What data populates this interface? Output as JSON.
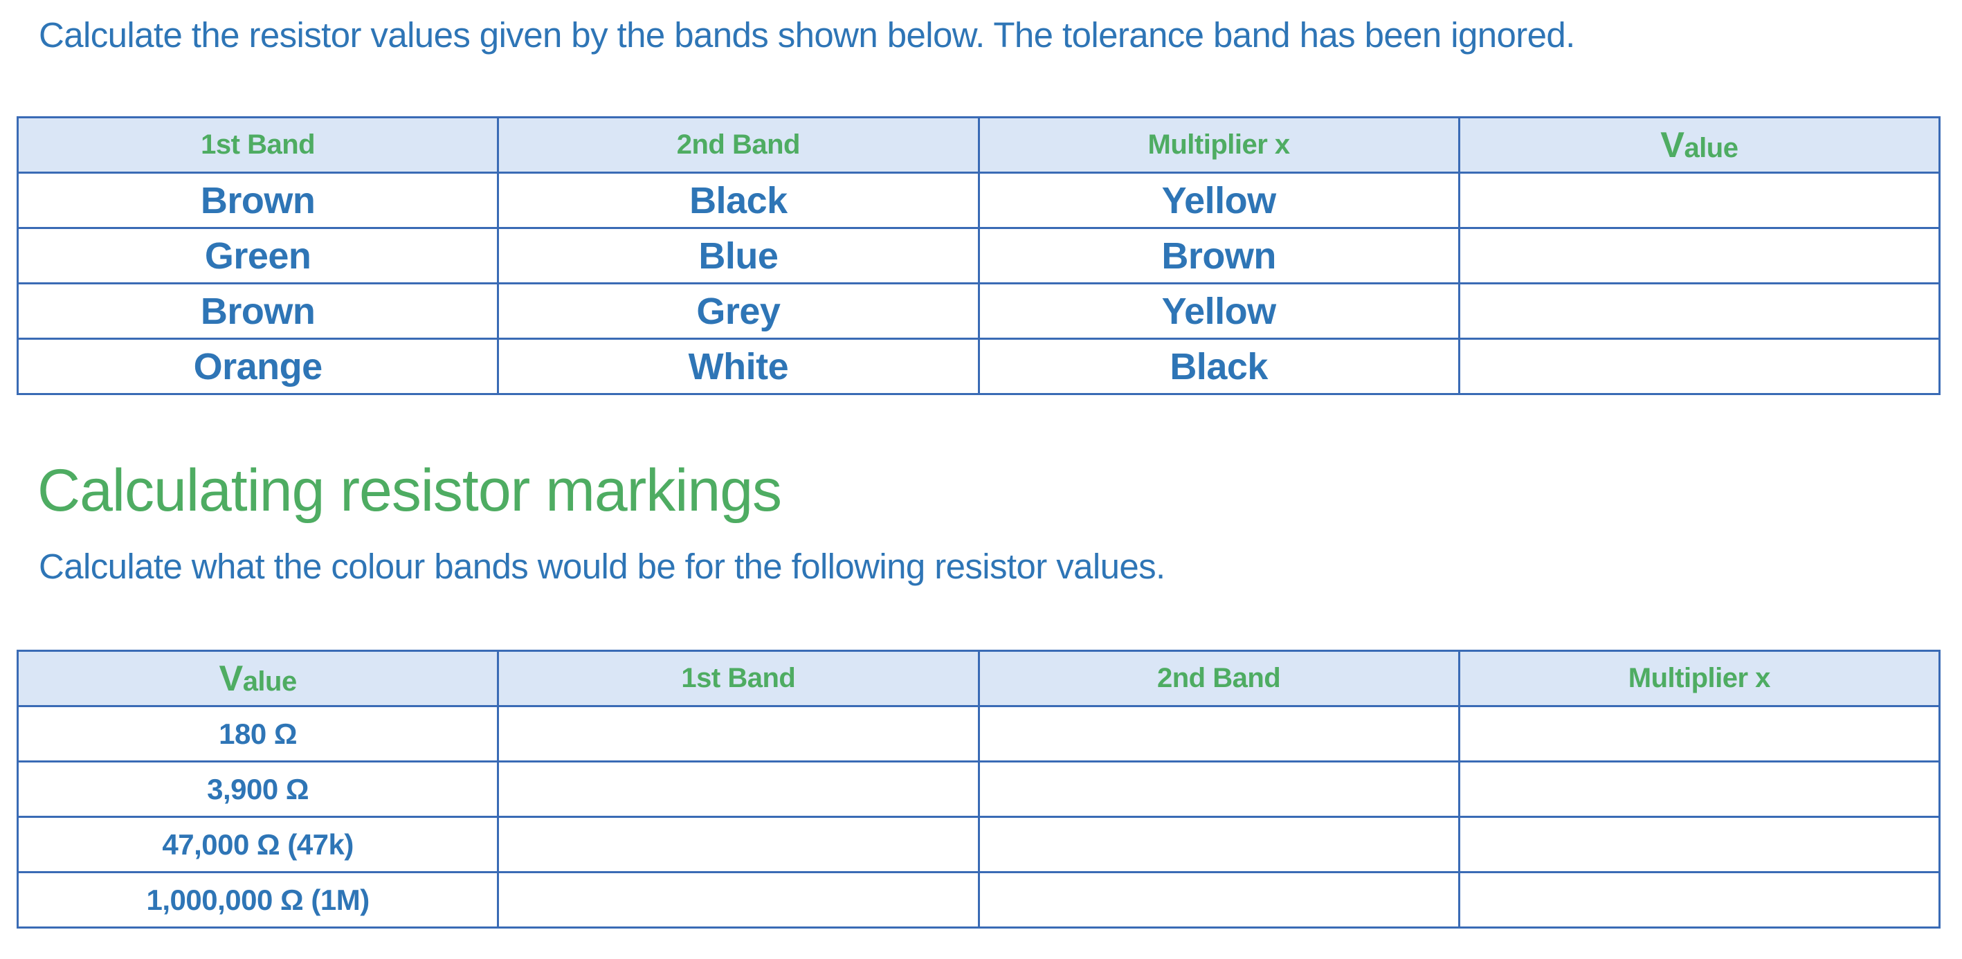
{
  "document": {
    "intro_text": "Calculate the resistor values given by the bands shown below. The tolerance band has been ignored.",
    "section_heading": "Calculating resistor markings",
    "section_instruction": "Calculate what the colour bands would be for the following resistor values.",
    "colors": {
      "body_text": "#2E75B6",
      "heading_text": "#4EAC62",
      "header_bg": "#DAE6F6",
      "border": "#3A6BB5"
    }
  },
  "bands_to_value_table": {
    "headers": [
      "1st Band",
      "2nd Band",
      "Multiplier x",
      "Value"
    ],
    "value_header_initial": "V",
    "value_header_rest": "alue",
    "rows": [
      {
        "first_band": "Brown",
        "second_band": "Black",
        "multiplier": "Yellow",
        "value": ""
      },
      {
        "first_band": "Green",
        "second_band": "Blue",
        "multiplier": "Brown",
        "value": ""
      },
      {
        "first_band": "Brown",
        "second_band": "Grey",
        "multiplier": "Yellow",
        "value": ""
      },
      {
        "first_band": "Orange",
        "second_band": "White",
        "multiplier": "Black",
        "value": ""
      }
    ]
  },
  "value_to_bands_table": {
    "headers": [
      "Value",
      "1st Band",
      "2nd Band",
      "Multiplier x"
    ],
    "value_header_initial": "V",
    "value_header_rest": "alue",
    "rows": [
      {
        "value": "180 Ω",
        "first_band": "",
        "second_band": "",
        "multiplier": ""
      },
      {
        "value": "3,900 Ω",
        "first_band": "",
        "second_band": "",
        "multiplier": ""
      },
      {
        "value": "47,000 Ω (47k)",
        "first_band": "",
        "second_band": "",
        "multiplier": ""
      },
      {
        "value": "1,000,000 Ω (1M)",
        "first_band": "",
        "second_band": "",
        "multiplier": ""
      }
    ]
  }
}
